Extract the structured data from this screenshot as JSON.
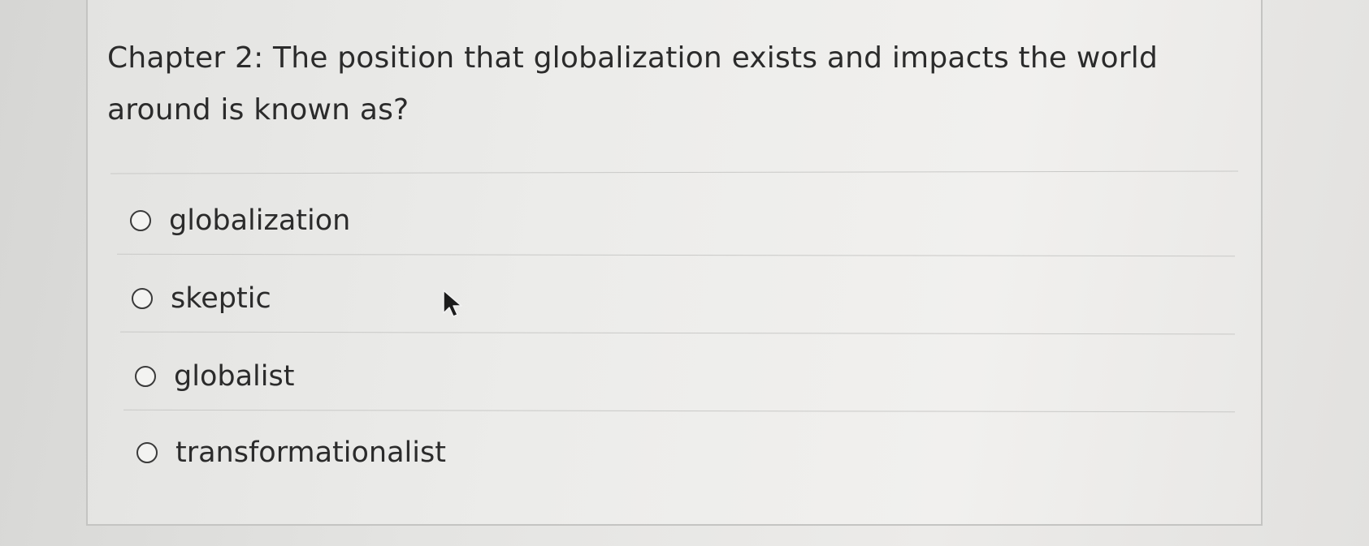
{
  "question": {
    "text": "Chapter 2:  The position that globalization exists and impacts the world around is known as?"
  },
  "options": [
    {
      "label": "globalization",
      "selected": false
    },
    {
      "label": "skeptic",
      "selected": false
    },
    {
      "label": "globalist",
      "selected": false
    },
    {
      "label": "transformationalist",
      "selected": false
    }
  ],
  "cursor": {
    "icon": "mouse-pointer-arrow-icon"
  }
}
